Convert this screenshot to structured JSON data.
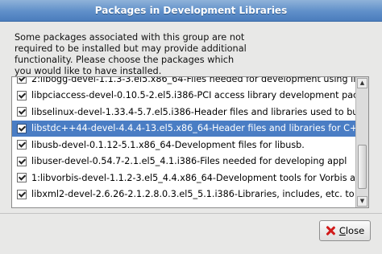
{
  "window": {
    "title": "Packages in Development Libraries"
  },
  "description": {
    "lines": [
      "Some packages associated with this group are not",
      "required to be installed but may provide additional",
      "functionality.  Please choose the packages which",
      "you would like to have installed."
    ]
  },
  "packages": [
    {
      "name": "2:libogg-devel-1.1.3-3.el5.x86_64",
      "desc": "Files needed for development using libo",
      "checked": true
    },
    {
      "name": "libpciaccess-devel-0.10.5-2.el5.i386",
      "desc": "PCI access library development pack",
      "checked": true
    },
    {
      "name": "libselinux-devel-1.33.4-5.7.el5.i386",
      "desc": "Header files and libraries used to buil",
      "checked": true
    },
    {
      "name": "libstdc++44-devel-4.4.4-13.el5.x86_64",
      "desc": "Header files and libraries for C++",
      "checked": true
    },
    {
      "name": "libusb-devel-0.1.12-5.1.x86_64",
      "desc": "Development files for libusb.",
      "checked": true
    },
    {
      "name": "libuser-devel-0.54.7-2.1.el5_4.1.i386",
      "desc": "Files needed for developing appl",
      "checked": true
    },
    {
      "name": "1:libvorbis-devel-1.1.2-3.el5_4.4.x86_64",
      "desc": "Development tools for Vorbis ap",
      "checked": true
    },
    {
      "name": "libxml2-devel-2.6.26-2.1.2.8.0.3.el5_5.1.i386",
      "desc": "Libraries, includes, etc. to c",
      "checked": true
    }
  ],
  "selected_index": 3,
  "separator": " - ",
  "close_button": {
    "label_prefix": "",
    "mnemonic": "C",
    "label_rest": "lose"
  },
  "colors": {
    "selection": "#4a7dc4",
    "titlebar": "#5f8fc9"
  }
}
